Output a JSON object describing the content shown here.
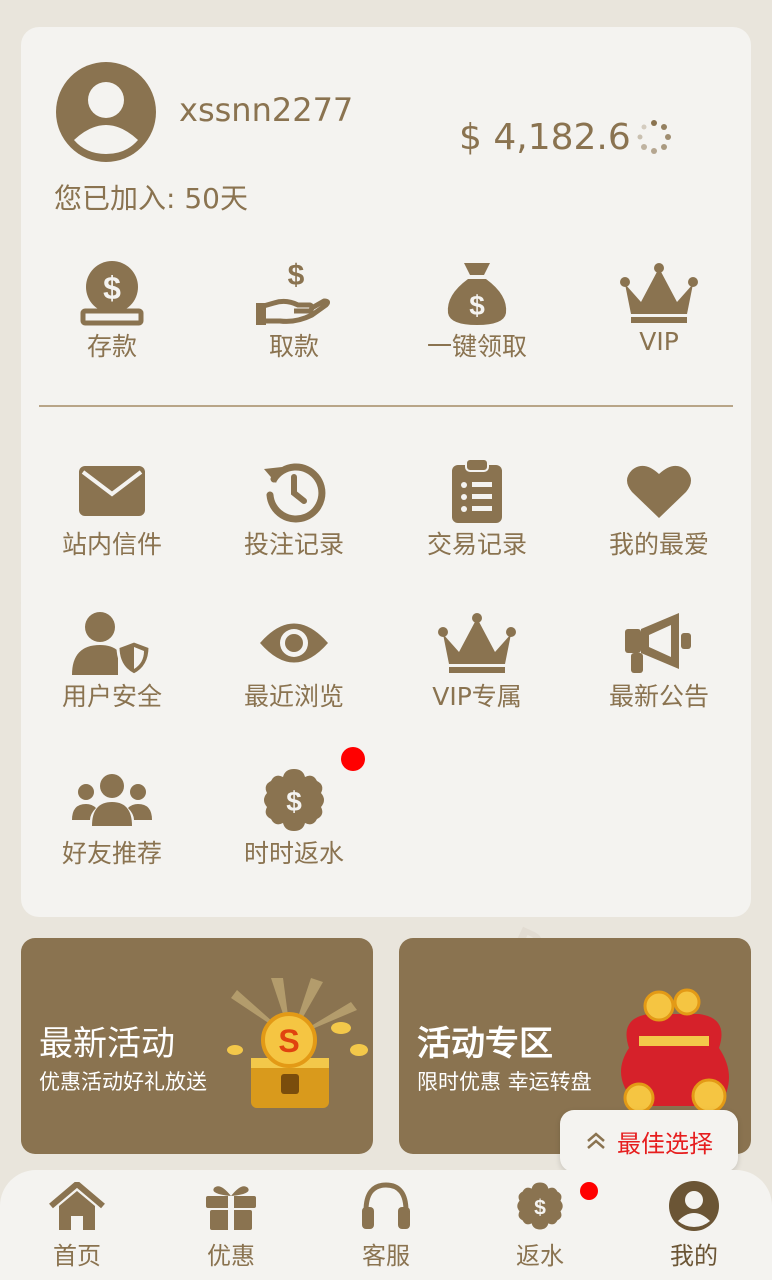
{
  "user": {
    "username": "xssnn2277",
    "balance": "$ 4,182.6",
    "joined": "您已加入: 50天"
  },
  "quick_actions": [
    {
      "label": "存款",
      "icon": "deposit-icon"
    },
    {
      "label": "取款",
      "icon": "withdraw-icon"
    },
    {
      "label": "一键领取",
      "icon": "money-bag-icon"
    },
    {
      "label": "VIP",
      "icon": "crown-icon"
    }
  ],
  "menu": [
    {
      "label": "站内信件",
      "icon": "mail-icon"
    },
    {
      "label": "投注记录",
      "icon": "history-icon"
    },
    {
      "label": "交易记录",
      "icon": "clipboard-icon"
    },
    {
      "label": "我的最爱",
      "icon": "heart-icon"
    },
    {
      "label": "用户安全",
      "icon": "user-shield-icon"
    },
    {
      "label": "最近浏览",
      "icon": "eye-icon"
    },
    {
      "label": "VIP专属",
      "icon": "crown-icon"
    },
    {
      "label": "最新公告",
      "icon": "megaphone-icon"
    },
    {
      "label": "好友推荐",
      "icon": "users-icon"
    },
    {
      "label": "时时返水",
      "icon": "rebate-icon"
    }
  ],
  "promos": [
    {
      "title": "最新活动",
      "subtitle": "优惠活动好礼放送"
    },
    {
      "title": "活动专区",
      "subtitle": "限时优惠 幸运转盘"
    }
  ],
  "best_choice": "最佳选择",
  "tabs": [
    {
      "label": "首页",
      "icon": "home-icon"
    },
    {
      "label": "优惠",
      "icon": "gift-icon"
    },
    {
      "label": "客服",
      "icon": "headset-icon"
    },
    {
      "label": "返水",
      "icon": "rebate-icon"
    },
    {
      "label": "我的",
      "icon": "user-icon"
    }
  ],
  "colors": {
    "brand": "#8a7350",
    "card": "#f4f3f0",
    "background": "#e9e5dc",
    "badge": "#ff0000"
  }
}
